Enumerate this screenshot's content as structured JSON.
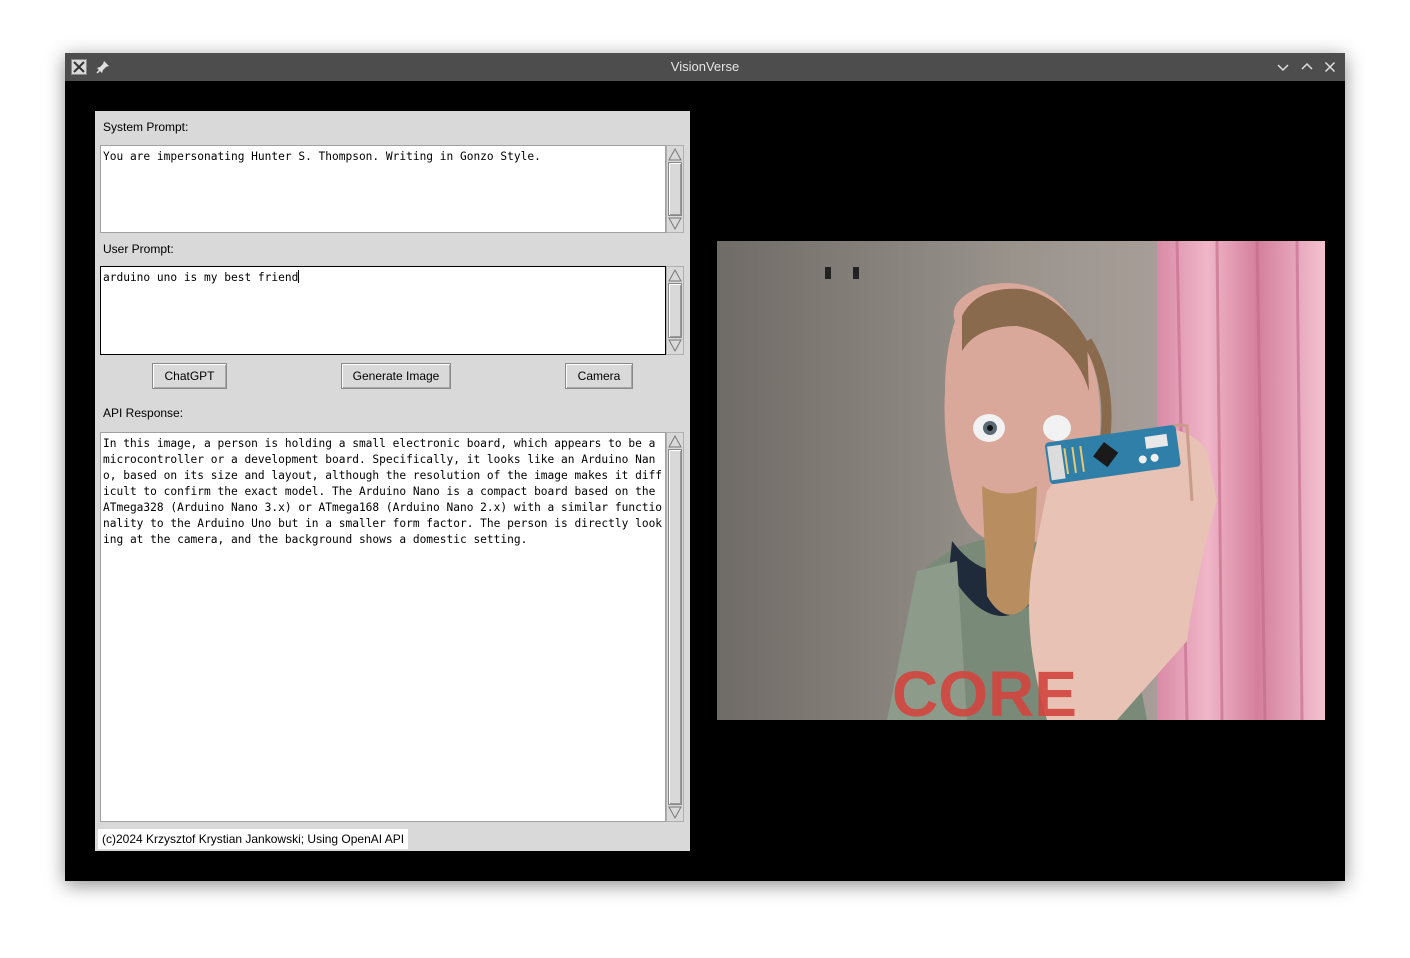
{
  "window": {
    "title": "VisionVerse"
  },
  "labels": {
    "system_prompt": "System Prompt:",
    "user_prompt": "User Prompt:",
    "api_response": "API Response:"
  },
  "inputs": {
    "system_prompt_value": "You are impersonating Hunter S. Thompson. Writing in Gonzo Style.",
    "user_prompt_value": "arduino uno is my best friend",
    "api_response_value": "In this image, a person is holding a small electronic board, which appears to be a microcontroller or a development board. Specifically, it looks like an Arduino Nano, based on its size and layout, although the resolution of the image makes it difficult to confirm the exact model. The Arduino Nano is a compact board based on the ATmega328 (Arduino Nano 3.x) or ATmega168 (Arduino Nano 2.x) with a similar functionality to the Arduino Uno but in a smaller form factor. The person is directly looking at the camera, and the background shows a domestic setting."
  },
  "buttons": {
    "chatgpt": "ChatGPT",
    "generate_image": "Generate Image",
    "camera": "Camera"
  },
  "footer": {
    "text": "(c)2024 Krzysztof Krystian Jankowski; Using OpenAI API"
  },
  "camera_feed": {
    "shirt_text": "CORE"
  },
  "colors": {
    "panel_bg": "#d9d9d9",
    "window_bg": "#000000",
    "titlebar_bg": "#4d4d4d"
  }
}
